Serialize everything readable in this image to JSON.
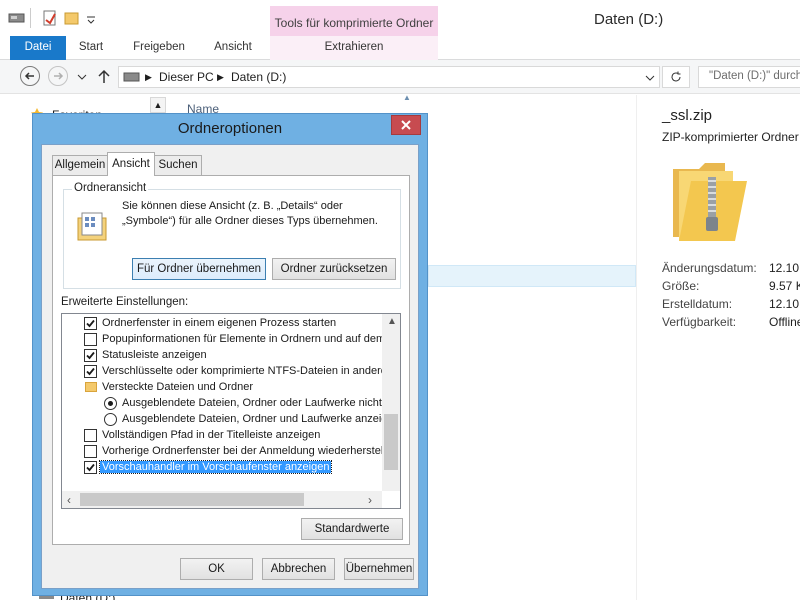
{
  "window": {
    "title": "Daten (D:)",
    "context_tab_header": "Tools für komprimierte Ordner"
  },
  "ribbon": {
    "tabs": [
      "Datei",
      "Start",
      "Freigeben",
      "Ansicht",
      "Extrahieren"
    ]
  },
  "address": {
    "crumbs": [
      "Dieser PC",
      "Daten (D:)"
    ],
    "search_placeholder": "\"Daten (D:)\" durchsuchen"
  },
  "navpane": {
    "items": [
      "Favoriten",
      "Daten (D:)"
    ]
  },
  "filelist": {
    "header_name": "Name"
  },
  "details": {
    "file_name": "_ssl.zip",
    "file_type": "ZIP-komprimierter Ordner",
    "rows": [
      {
        "label": "Änderungsdatum:",
        "value": "12.10.2"
      },
      {
        "label": "Größe:",
        "value": "9.57 K"
      },
      {
        "label": "Erstelldatum:",
        "value": "12.10.2"
      },
      {
        "label": "Verfügbarkeit:",
        "value": "Offline"
      }
    ]
  },
  "dialog": {
    "title": "Ordneroptionen",
    "tabs": [
      "Allgemein",
      "Ansicht",
      "Suchen"
    ],
    "active_tab": "Ansicht",
    "group_title": "Ordneransicht",
    "group_desc": "Sie können diese Ansicht (z. B. „Details“ oder „Symbole“) für alle Ordner dieses Typs übernehmen.",
    "btn_apply_folders": "Für Ordner übernehmen",
    "btn_reset_folders": "Ordner zurücksetzen",
    "advanced_label": "Erweiterte Einstellungen:",
    "settings": [
      {
        "type": "checkbox",
        "checked": true,
        "indent": 1,
        "label": "Ordnerfenster in einem eigenen Prozess starten"
      },
      {
        "type": "checkbox",
        "checked": false,
        "indent": 1,
        "label": "Popupinformationen für Elemente in Ordnern und auf dem Desktop anzeigen"
      },
      {
        "type": "checkbox",
        "checked": true,
        "indent": 1,
        "label": "Statusleiste anzeigen"
      },
      {
        "type": "checkbox",
        "checked": true,
        "indent": 1,
        "label": "Verschlüsselte oder komprimierte NTFS-Dateien in anderer Farbe anzeigen"
      },
      {
        "type": "folder",
        "indent": 1,
        "label": "Versteckte Dateien und Ordner"
      },
      {
        "type": "radio",
        "checked": true,
        "indent": 2,
        "label": "Ausgeblendete Dateien, Ordner oder Laufwerke nicht anzeigen"
      },
      {
        "type": "radio",
        "checked": false,
        "indent": 2,
        "label": "Ausgeblendete Dateien, Ordner und Laufwerke anzeigen"
      },
      {
        "type": "checkbox",
        "checked": false,
        "indent": 1,
        "label": "Vollständigen Pfad in der Titelleiste anzeigen"
      },
      {
        "type": "checkbox",
        "checked": false,
        "indent": 1,
        "label": "Vorherige Ordnerfenster bei der Anmeldung wiederherstellen"
      },
      {
        "type": "checkbox",
        "checked": true,
        "indent": 1,
        "selected": true,
        "label": "Vorschauhandler im Vorschaufenster anzeigen"
      }
    ],
    "btn_defaults": "Standardwerte",
    "btn_ok": "OK",
    "btn_cancel": "Abbrechen",
    "btn_apply": "Übernehmen"
  }
}
